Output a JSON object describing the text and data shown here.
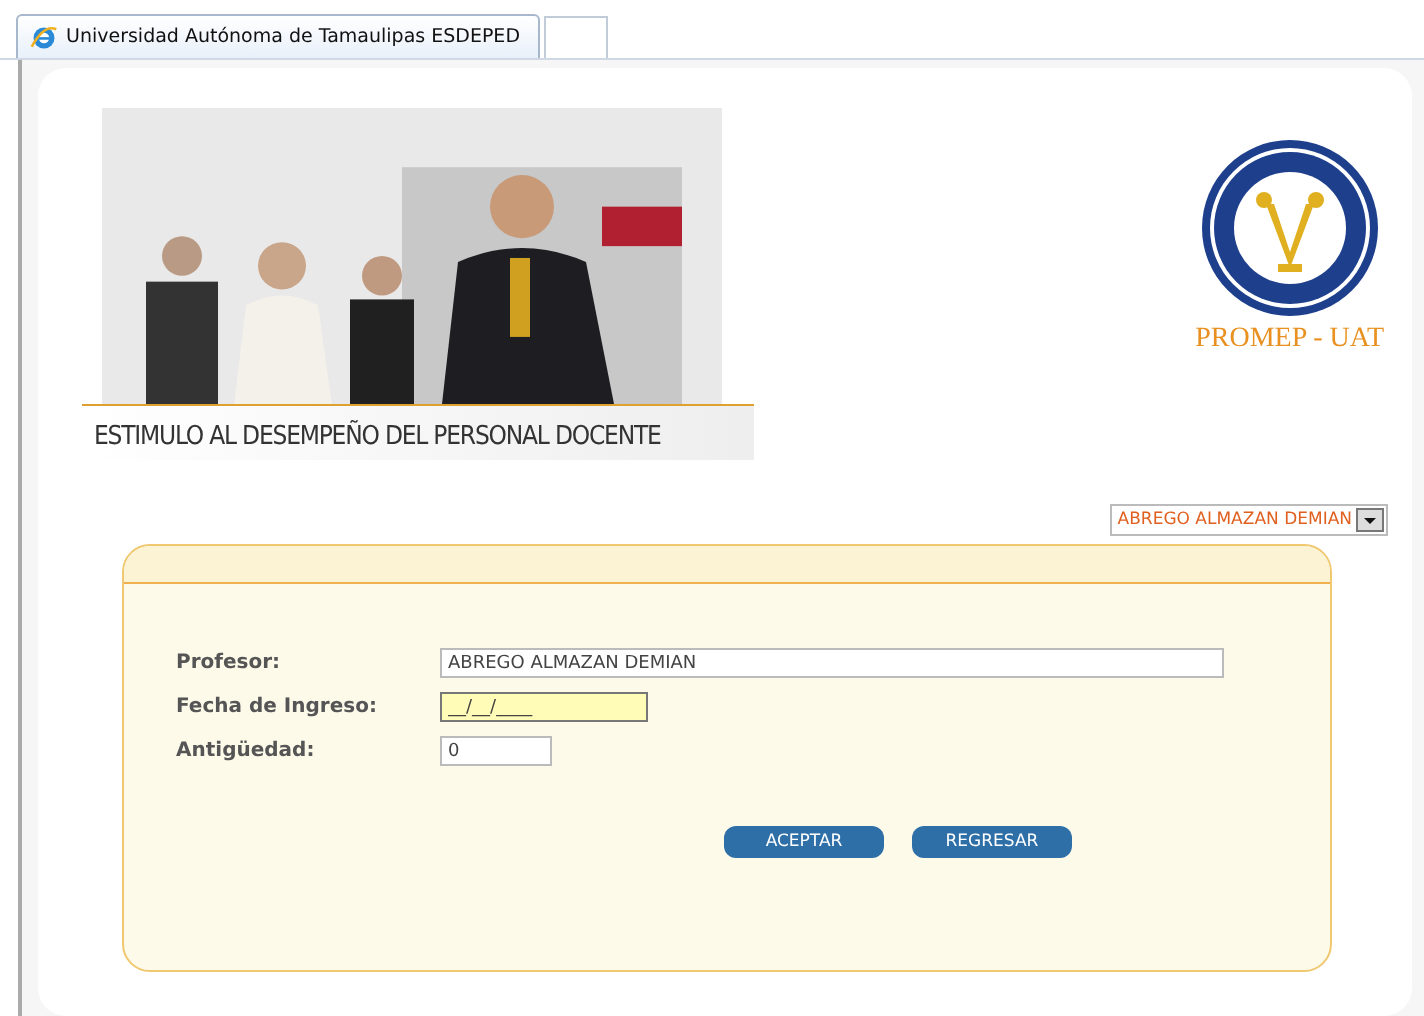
{
  "browser_tab": {
    "title": "Universidad Autónoma de Tamaulipas ESDEPED"
  },
  "header": {
    "logo_caption": "PROMEP - UAT",
    "title": "ESTIMULO AL DESEMPEÑO DEL PERSONAL DOCENTE"
  },
  "professor_select": {
    "value": "ABREGO ALMAZAN DEMIAN"
  },
  "form": {
    "fields": [
      {
        "label": "Profesor:",
        "value": "ABREGO ALMAZAN DEMIAN",
        "focused": false
      },
      {
        "label": "Fecha de Ingreso:",
        "value": "__/__/____",
        "focused": true
      },
      {
        "label": "Antigüedad:",
        "value": "0",
        "focused": false
      }
    ],
    "buttons": [
      "ACEPTAR",
      "REGRESAR"
    ]
  }
}
